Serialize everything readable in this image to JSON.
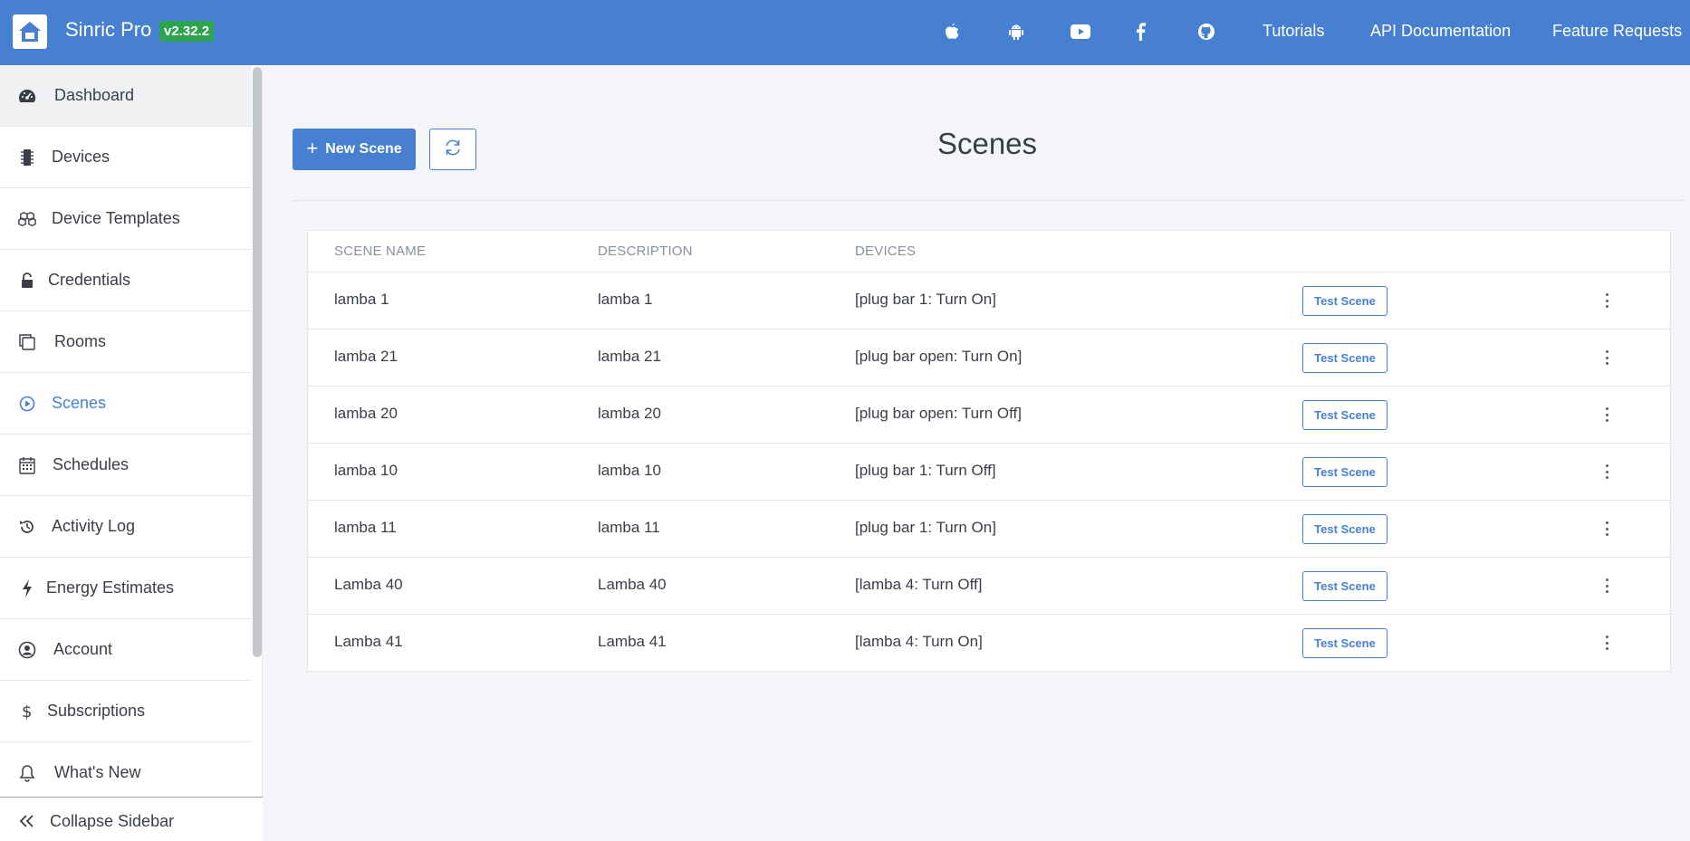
{
  "header": {
    "brand": "Sinric Pro",
    "version": "v2.32.2",
    "icons": [
      "apple-icon",
      "android-icon",
      "youtube-icon",
      "facebook-icon",
      "github-icon"
    ],
    "links": [
      "Tutorials",
      "API Documentation",
      "Feature Requests"
    ]
  },
  "sidebar": {
    "items": [
      {
        "label": "Dashboard",
        "icon": "dashboard-icon"
      },
      {
        "label": "Devices",
        "icon": "chip-icon"
      },
      {
        "label": "Device Templates",
        "icon": "cubes-icon"
      },
      {
        "label": "Credentials",
        "icon": "lock-icon"
      },
      {
        "label": "Rooms",
        "icon": "copy-icon"
      },
      {
        "label": "Scenes",
        "icon": "play-circle-icon"
      },
      {
        "label": "Schedules",
        "icon": "calendar-icon"
      },
      {
        "label": "Activity Log",
        "icon": "history-icon"
      },
      {
        "label": "Energy Estimates",
        "icon": "bolt-icon"
      },
      {
        "label": "Account",
        "icon": "user-circle-icon"
      },
      {
        "label": "Subscriptions",
        "icon": "dollar-icon"
      },
      {
        "label": "What's New",
        "icon": "bell-icon"
      }
    ],
    "active": "Scenes",
    "collapse_label": "Collapse Sidebar"
  },
  "main": {
    "new_scene_label": "New Scene",
    "title": "Scenes",
    "columns": [
      "SCENE NAME",
      "DESCRIPTION",
      "DEVICES"
    ],
    "test_label": "Test Scene",
    "rows": [
      {
        "name": "lamba 1",
        "description": "lamba 1",
        "devices": "[plug bar 1: Turn On]"
      },
      {
        "name": "lamba 21",
        "description": "lamba 21",
        "devices": "[plug bar open: Turn On]"
      },
      {
        "name": "lamba 20",
        "description": "lamba 20",
        "devices": "[plug bar open: Turn Off]"
      },
      {
        "name": "lamba 10",
        "description": "lamba 10",
        "devices": "[plug bar 1: Turn Off]"
      },
      {
        "name": "lamba 11",
        "description": "lamba 11",
        "devices": "[plug bar 1: Turn On]"
      },
      {
        "name": "Lamba 40",
        "description": "Lamba 40",
        "devices": "[lamba 4: Turn Off]"
      },
      {
        "name": "Lamba 41",
        "description": "Lamba 41",
        "devices": "[lamba 4: Turn On]"
      }
    ]
  },
  "colors": {
    "primary": "#4780d0",
    "version_badge": "#2ea44f",
    "background": "#f4f5f8"
  }
}
